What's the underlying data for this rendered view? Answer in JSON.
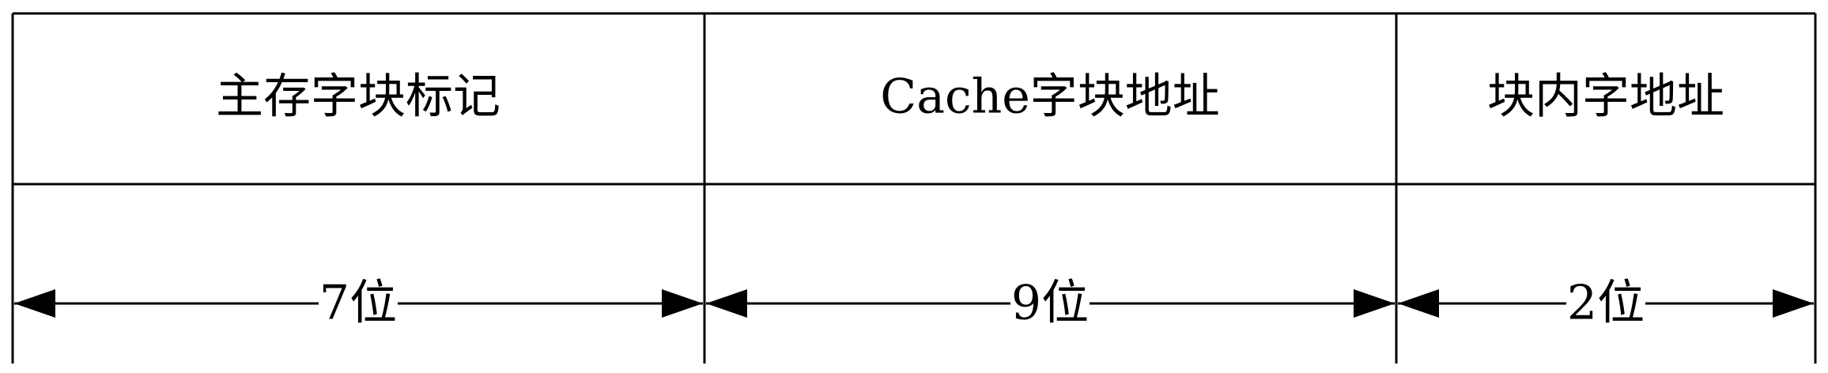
{
  "fields": [
    {
      "label": "主存字块标记",
      "width_label": "7位"
    },
    {
      "label": "Cache字块地址",
      "width_label": "9位"
    },
    {
      "label": "块内字地址",
      "width_label": "2位"
    }
  ]
}
